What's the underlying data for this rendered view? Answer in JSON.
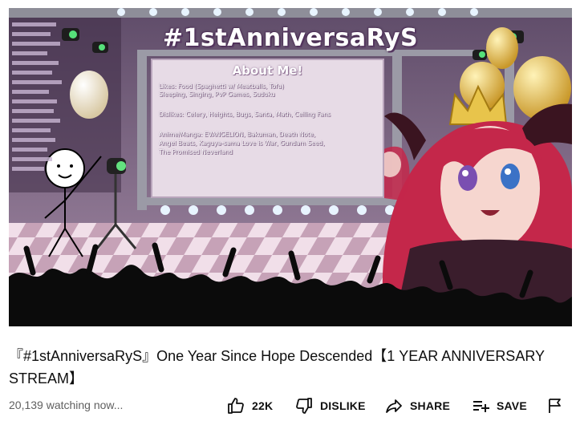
{
  "video": {
    "scene": {
      "banner": "#1stAnniversaRyS",
      "panel_title": "About Me!",
      "panel_lines": [
        "Likes: Food (Spaghetti w/ Meatballs, Tofu)",
        "Sleeping, Singing, PvP Games, Sudoku",
        "",
        "Dislikes: Celery, Heights, Bugs, Santa, Math, Ceiling Fans",
        "",
        "Anime/Manga: EVANGELION, Bakuman, Death Note,",
        "Angel Beats, Kaguya-sama Love is War, Gundam Seed,",
        "The Promised Neverland"
      ]
    }
  },
  "title": "『#1stAnniversaRyS』One Year Since Hope Descended【1 YEAR ANNIVERSARY STREAM】",
  "views": "20,139 watching now...",
  "actions": {
    "like_count": "22K",
    "dislike_label": "DISLIKE",
    "share_label": "SHARE",
    "save_label": "SAVE"
  },
  "icons": {
    "like": "thumbs-up-icon",
    "dislike": "thumbs-down-icon",
    "share": "share-arrow-icon",
    "save": "playlist-add-icon",
    "report": "flag-icon"
  },
  "colors": {
    "text_primary": "#0f0f0f",
    "text_secondary": "#606060",
    "stage_bg": "#7d6a86",
    "panel_bg": "#e7dbe6",
    "hair": "#c4274a",
    "crown": "#e8c44b"
  }
}
